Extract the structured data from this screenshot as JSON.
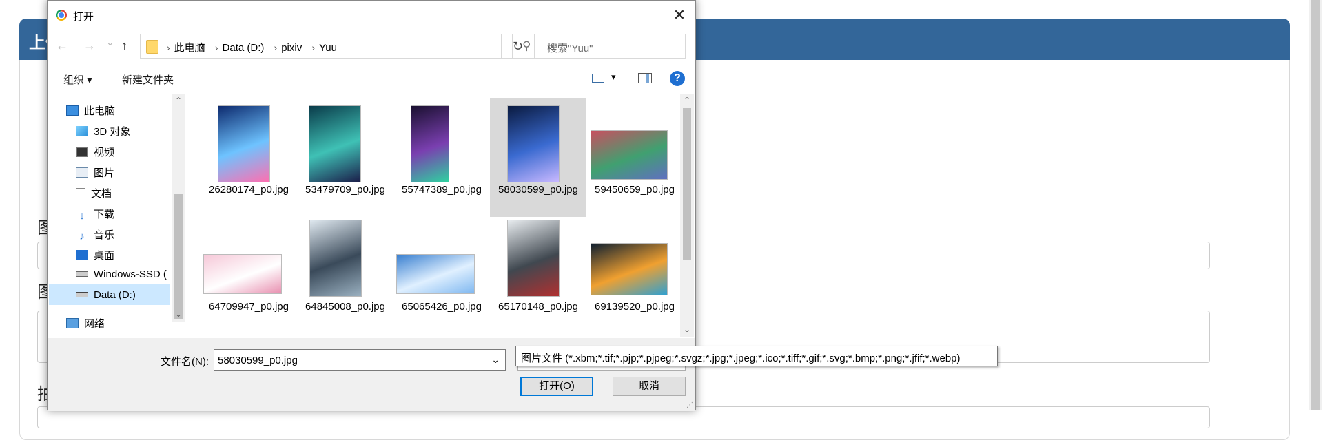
{
  "background": {
    "header_title": "上传",
    "labels": [
      "图",
      "图",
      "拍"
    ]
  },
  "dialog": {
    "title": "打开",
    "close_symbol": "✕",
    "nav": {
      "back": "←",
      "forward": "→",
      "recent": "⌄",
      "up": "↑",
      "refresh": "↻",
      "dropdown": "⌄"
    },
    "breadcrumb": [
      "此电脑",
      "Data (D:)",
      "pixiv",
      "Yuu"
    ],
    "breadcrumb_separator": "›",
    "search_placeholder": "搜索\"Yuu\"",
    "toolbar": {
      "organize": "组织 ▾",
      "new_folder": "新建文件夹",
      "view_dropdown": "▾",
      "help": "?"
    },
    "nav_pane": [
      {
        "label": "此电脑",
        "icon": "computer-icon"
      },
      {
        "label": "3D 对象",
        "icon": "cube-icon"
      },
      {
        "label": "视频",
        "icon": "video-icon"
      },
      {
        "label": "图片",
        "icon": "picture-icon"
      },
      {
        "label": "文档",
        "icon": "document-icon"
      },
      {
        "label": "下载",
        "icon": "download-icon"
      },
      {
        "label": "音乐",
        "icon": "music-icon"
      },
      {
        "label": "桌面",
        "icon": "desktop-icon"
      },
      {
        "label": "Windows-SSD (",
        "icon": "drive-icon"
      },
      {
        "label": "Data (D:)",
        "icon": "drive-icon",
        "selected": true
      },
      {
        "label": "网络",
        "icon": "network-icon"
      }
    ],
    "files": [
      {
        "name": "26280174_p0.jpg",
        "colors": [
          "#0d2a6e",
          "#6ec3ff",
          "#ff6fb0"
        ]
      },
      {
        "name": "53479709_p0.jpg",
        "colors": [
          "#0a3b4a",
          "#3fc1b5",
          "#1b1e4a"
        ]
      },
      {
        "name": "55747389_p0.jpg",
        "colors": [
          "#1a1030",
          "#7a3fb0",
          "#2fd1a0"
        ]
      },
      {
        "name": "58030599_p0.jpg",
        "colors": [
          "#0a1a40",
          "#3a6ad0",
          "#c8b8ff"
        ],
        "selected": true
      },
      {
        "name": "59450659_p0.jpg",
        "colors": [
          "#c85060",
          "#40a070",
          "#6070c0"
        ]
      },
      {
        "name": "64709947_p0.jpg",
        "colors": [
          "#f6c8d8",
          "#ffffff",
          "#e890b0"
        ]
      },
      {
        "name": "64845008_p0.jpg",
        "colors": [
          "#dfe8ef",
          "#3a4a5a",
          "#9ab0c0"
        ]
      },
      {
        "name": "65065426_p0.jpg",
        "colors": [
          "#3a80d0",
          "#e0f0ff",
          "#80b8f0"
        ]
      },
      {
        "name": "65170148_p0.jpg",
        "colors": [
          "#e8ecef",
          "#404850",
          "#b03030"
        ]
      },
      {
        "name": "69139520_p0.jpg",
        "colors": [
          "#102030",
          "#f0a030",
          "#30a0d0"
        ]
      }
    ],
    "filename_label": "文件名(N):",
    "filename_value": "58030599_p0.jpg",
    "filename_dropdown": "⌄",
    "filetype_tooltip": "图片文件 (*.xbm;*.tif;*.pjp;*.pjpeg;*.svgz;*.jpg;*.jpeg;*.ico;*.tiff;*.gif;*.svg;*.bmp;*.png;*.jfif;*.webp)",
    "open_button": "打开(O)",
    "cancel_button": "取消"
  }
}
